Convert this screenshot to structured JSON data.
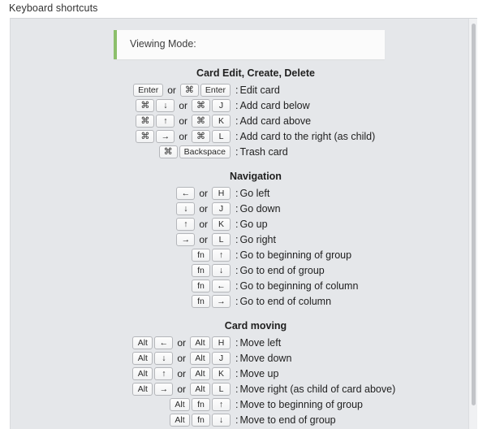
{
  "header": {
    "title": "Keyboard shortcuts"
  },
  "callout": {
    "label": "Viewing Mode:",
    "accent_color": "#8cbf6b"
  },
  "colors": {
    "panel_background": "#e5e7ea",
    "page_background": "#ffffff",
    "callout_background": "#fbfbfb",
    "key_border": "#b4b6ba",
    "text": "#1f1f1f"
  },
  "sections": [
    {
      "title": "Card Edit, Create, Delete",
      "rows": [
        {
          "combos": [
            [
              "Enter"
            ],
            [
              "⌘",
              "Enter"
            ]
          ],
          "separator": "or",
          "description": "Edit card"
        },
        {
          "combos": [
            [
              "⌘",
              "↓"
            ],
            [
              "⌘",
              "J"
            ]
          ],
          "separator": "or",
          "description": "Add card below"
        },
        {
          "combos": [
            [
              "⌘",
              "↑"
            ],
            [
              "⌘",
              "K"
            ]
          ],
          "separator": "or",
          "description": "Add card above"
        },
        {
          "combos": [
            [
              "⌘",
              "→"
            ],
            [
              "⌘",
              "L"
            ]
          ],
          "separator": "or",
          "description": "Add card to the right (as child)"
        },
        {
          "combos": [
            [
              "⌘",
              "Backspace"
            ]
          ],
          "separator": "",
          "description": "Trash card"
        }
      ]
    },
    {
      "title": "Navigation",
      "rows": [
        {
          "combos": [
            [
              "←"
            ],
            [
              "H"
            ]
          ],
          "separator": "or",
          "description": "Go left"
        },
        {
          "combos": [
            [
              "↓"
            ],
            [
              "J"
            ]
          ],
          "separator": "or",
          "description": "Go down"
        },
        {
          "combos": [
            [
              "↑"
            ],
            [
              "K"
            ]
          ],
          "separator": "or",
          "description": "Go up"
        },
        {
          "combos": [
            [
              "→"
            ],
            [
              "L"
            ]
          ],
          "separator": "or",
          "description": "Go right"
        },
        {
          "combos": [
            [
              "fn",
              "↑"
            ]
          ],
          "separator": "",
          "description": "Go to beginning of group"
        },
        {
          "combos": [
            [
              "fn",
              "↓"
            ]
          ],
          "separator": "",
          "description": "Go to end of group"
        },
        {
          "combos": [
            [
              "fn",
              "←"
            ]
          ],
          "separator": "",
          "description": "Go to beginning of column"
        },
        {
          "combos": [
            [
              "fn",
              "→"
            ]
          ],
          "separator": "",
          "description": "Go to end of column"
        }
      ]
    },
    {
      "title": "Card moving",
      "rows": [
        {
          "combos": [
            [
              "Alt",
              "←"
            ],
            [
              "Alt",
              "H"
            ]
          ],
          "separator": "or",
          "description": "Move left"
        },
        {
          "combos": [
            [
              "Alt",
              "↓"
            ],
            [
              "Alt",
              "J"
            ]
          ],
          "separator": "or",
          "description": "Move down"
        },
        {
          "combos": [
            [
              "Alt",
              "↑"
            ],
            [
              "Alt",
              "K"
            ]
          ],
          "separator": "or",
          "description": "Move up"
        },
        {
          "combos": [
            [
              "Alt",
              "→"
            ],
            [
              "Alt",
              "L"
            ]
          ],
          "separator": "or",
          "description": "Move right (as child of card above)"
        },
        {
          "combos": [
            [
              "Alt",
              "fn",
              "↑"
            ]
          ],
          "separator": "",
          "description": "Move to beginning of group"
        },
        {
          "combos": [
            [
              "Alt",
              "fn",
              "↓"
            ]
          ],
          "separator": "",
          "description": "Move to end of group"
        }
      ]
    }
  ]
}
